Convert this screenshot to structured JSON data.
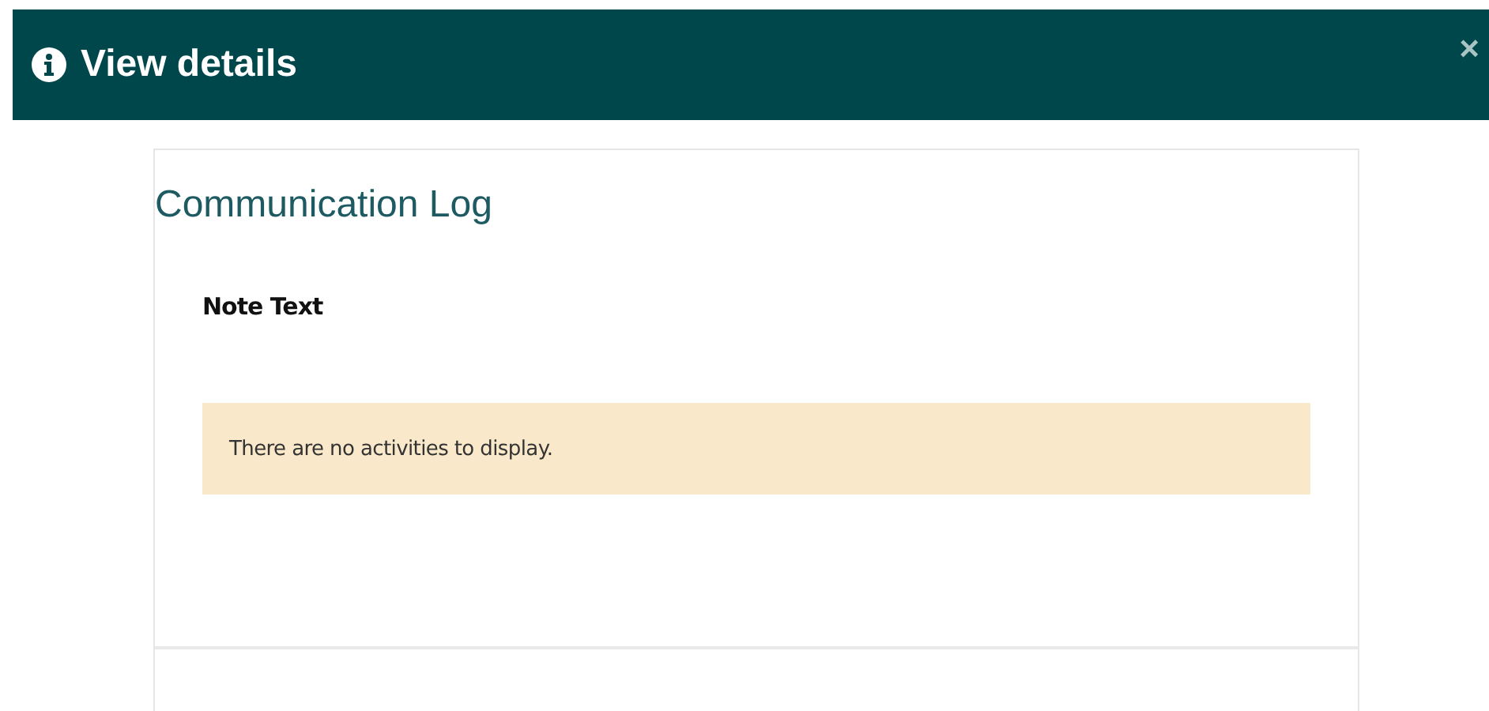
{
  "dialog": {
    "title": "View details",
    "close": "×"
  },
  "section": {
    "title": "Communication Log",
    "field_label": "Note Text",
    "empty_message": "There are no activities to display."
  }
}
